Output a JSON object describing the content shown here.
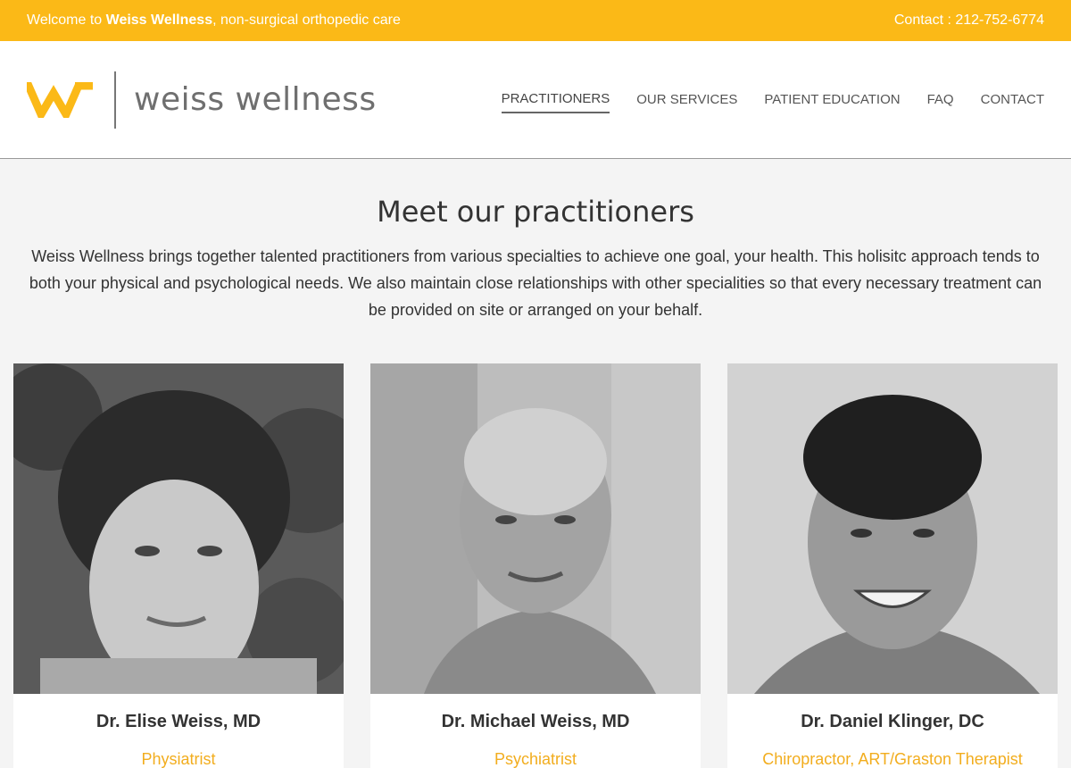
{
  "topbar": {
    "welcome_prefix": "Welcome to ",
    "welcome_brand": "Weiss Wellness",
    "welcome_suffix": ", non-surgical orthopedic care",
    "contact": "Contact : 212-752-6774"
  },
  "brand": {
    "wordmark": "weiss wellness",
    "accent_color": "#fbb917",
    "logo_icon": "w-logo-icon"
  },
  "nav": {
    "items": [
      {
        "label": "PRACTITIONERS",
        "active": true
      },
      {
        "label": "OUR SERVICES",
        "active": false
      },
      {
        "label": "PATIENT EDUCATION",
        "active": false
      },
      {
        "label": "FAQ",
        "active": false
      },
      {
        "label": "CONTACT",
        "active": false
      }
    ]
  },
  "intro": {
    "title": "Meet our practitioners",
    "body": "Weiss Wellness brings together talented practitioners from various specialties to achieve one goal, your health. This holisitc approach tends to both your physical and psychological needs. We also maintain close relationships with other specialities so that every necessary treatment can be provided on site or arranged on your behalf."
  },
  "practitioners": [
    {
      "name": "Dr. Elise Weiss, MD",
      "role": "Physiatrist"
    },
    {
      "name": "Dr. Michael Weiss, MD",
      "role": "Psychiatrist"
    },
    {
      "name": "Dr. Daniel Klinger, DC",
      "role": "Chiropractor, ART/Graston Therapist"
    }
  ]
}
